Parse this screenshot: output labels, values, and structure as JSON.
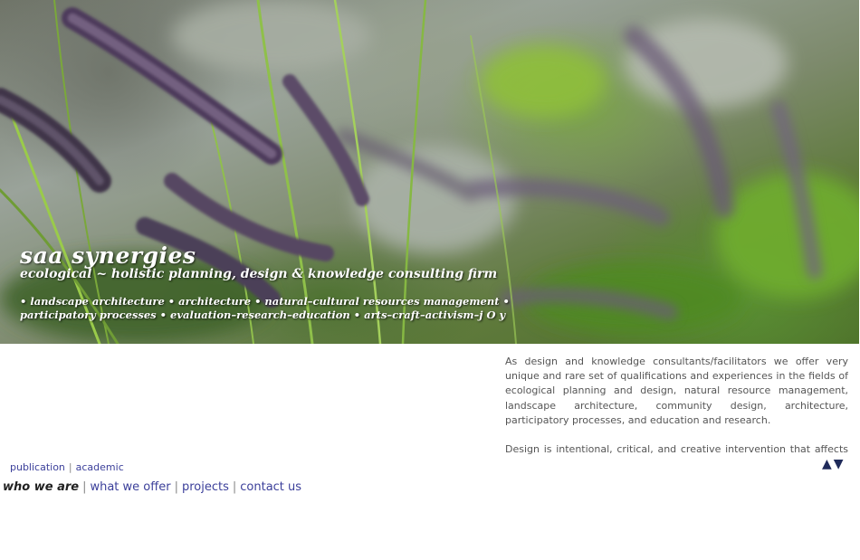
{
  "hero": {
    "brand": "saa synergies",
    "tagline": "ecological ~ holistic planning, design & knowledge consulting firm",
    "services_line1": "• landscape architecture • architecture • natural–cultural resources management •",
    "services_line2": "participatory processes • evaluation–research–education • arts–craft–activism–j O y",
    "image_description": "grass"
  },
  "intro": {
    "paragraph1": "As design and knowledge consultants/facilitators we offer very unique and rare set of qualifications and experiences in the fields of ecological planning and design, natural resource management, landscape architecture, community design, architecture, participatory processes, and education and research.",
    "paragraph2": "Design is intentional, critical, and creative intervention that affects quality"
  },
  "scroll": {
    "up": "▲",
    "down": "▼"
  },
  "sub_links": {
    "publication": "publication",
    "academic": "academic",
    "separator": "|"
  },
  "main_nav": {
    "who_we_are": "who we are",
    "what_we_offer": "what we offer",
    "projects": "projects",
    "contact_us": "contact us",
    "separator": "|"
  },
  "colors": {
    "link": "#3b3f9a",
    "body_text": "#555555",
    "arrow": "#1f2a5a"
  }
}
